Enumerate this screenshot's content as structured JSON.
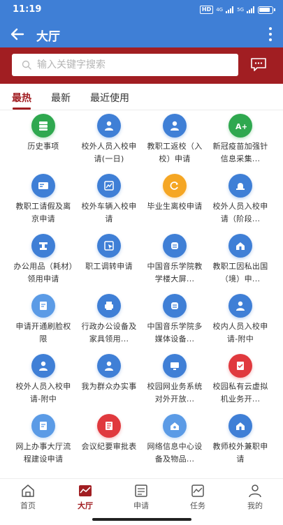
{
  "status_bar": {
    "time": "11:19",
    "hd": "HD",
    "network1": "4G",
    "network2": "5G"
  },
  "header": {
    "title": "大厅",
    "back_icon": "arrow-left-icon",
    "more_icon": "more-vertical-icon"
  },
  "search": {
    "placeholder": "输入关键字搜索",
    "value": "",
    "message_icon": "chat-bubble-icon"
  },
  "tabs": [
    {
      "label": "最热",
      "active": true
    },
    {
      "label": "最新",
      "active": false
    },
    {
      "label": "最近使用",
      "active": false
    }
  ],
  "grid": [
    {
      "label": "历史事项",
      "icon": "server-icon",
      "color": "#2FA84F"
    },
    {
      "label": "校外人员入校申请(一日)",
      "icon": "person-icon",
      "color": "#3F7FD6"
    },
    {
      "label": "教职工返校（入校）申请",
      "icon": "person-icon",
      "color": "#3F7FD6"
    },
    {
      "label": "新冠疫苗加强针信息采集...",
      "icon": "a-plus-icon",
      "color": "#2FA84F"
    },
    {
      "label": "教职工请假及离京申请",
      "icon": "id-card-icon",
      "color": "#3F7FD6"
    },
    {
      "label": "校外车辆入校申请",
      "icon": "chart-icon",
      "color": "#3F7FD6"
    },
    {
      "label": "毕业生离校申请",
      "icon": "sync-icon",
      "color": "#F5A623"
    },
    {
      "label": "校外人员入校申请（阶段...",
      "icon": "siren-icon",
      "color": "#3F7FD6"
    },
    {
      "label": "办公用品（耗材）领用申请",
      "icon": "stamp-icon",
      "color": "#3F7FD6"
    },
    {
      "label": "职工调转申请",
      "icon": "cursor-icon",
      "color": "#3F7FD6"
    },
    {
      "label": "中国音乐学院教学楼大屏...",
      "icon": "swap-icon",
      "color": "#3F7FD6"
    },
    {
      "label": "教职工因私出国（境）申...",
      "icon": "home-icon",
      "color": "#3F7FD6"
    },
    {
      "label": "申请开通刷脸权限",
      "icon": "edit-doc-icon",
      "color": "#5B9BE6"
    },
    {
      "label": "行政办公设备及家具领用...",
      "icon": "printer-icon",
      "color": "#3F7FD6"
    },
    {
      "label": "中国音乐学院多媒体设备...",
      "icon": "swap-icon",
      "color": "#3F7FD6"
    },
    {
      "label": "校内人员入校申请-附中",
      "icon": "person-icon",
      "color": "#3F7FD6"
    },
    {
      "label": "校外人员入校申请-附中",
      "icon": "person-icon",
      "color": "#3F7FD6"
    },
    {
      "label": "我为群众办实事",
      "icon": "person-icon",
      "color": "#3F7FD6"
    },
    {
      "label": "校园网业务系统对外开放...",
      "icon": "monitor-icon",
      "color": "#3F7FD6"
    },
    {
      "label": "校园私有云虚拟机业务开...",
      "icon": "doc-check-icon",
      "color": "#E0393E"
    },
    {
      "label": "网上办事大厅流程建设申请",
      "icon": "edit-doc-icon",
      "color": "#5B9BE6"
    },
    {
      "label": "会议纪要审批表",
      "icon": "doc-list-icon",
      "color": "#E0393E"
    },
    {
      "label": "网络信息中心设备及物品...",
      "icon": "house-heart-icon",
      "color": "#5B9BE6"
    },
    {
      "label": "教师校外兼职申请",
      "icon": "home-icon",
      "color": "#3F7FD6"
    }
  ],
  "bottom_nav": [
    {
      "label": "首页",
      "icon": "home-outline-icon",
      "active": false
    },
    {
      "label": "大厅",
      "icon": "trend-icon",
      "active": true
    },
    {
      "label": "申请",
      "icon": "form-icon",
      "active": false
    },
    {
      "label": "任务",
      "icon": "task-icon",
      "active": false
    },
    {
      "label": "我的",
      "icon": "user-icon",
      "active": false
    }
  ],
  "colors": {
    "primary": "#3F7FD6",
    "brand": "#A11E22",
    "active": "#A11E22"
  }
}
